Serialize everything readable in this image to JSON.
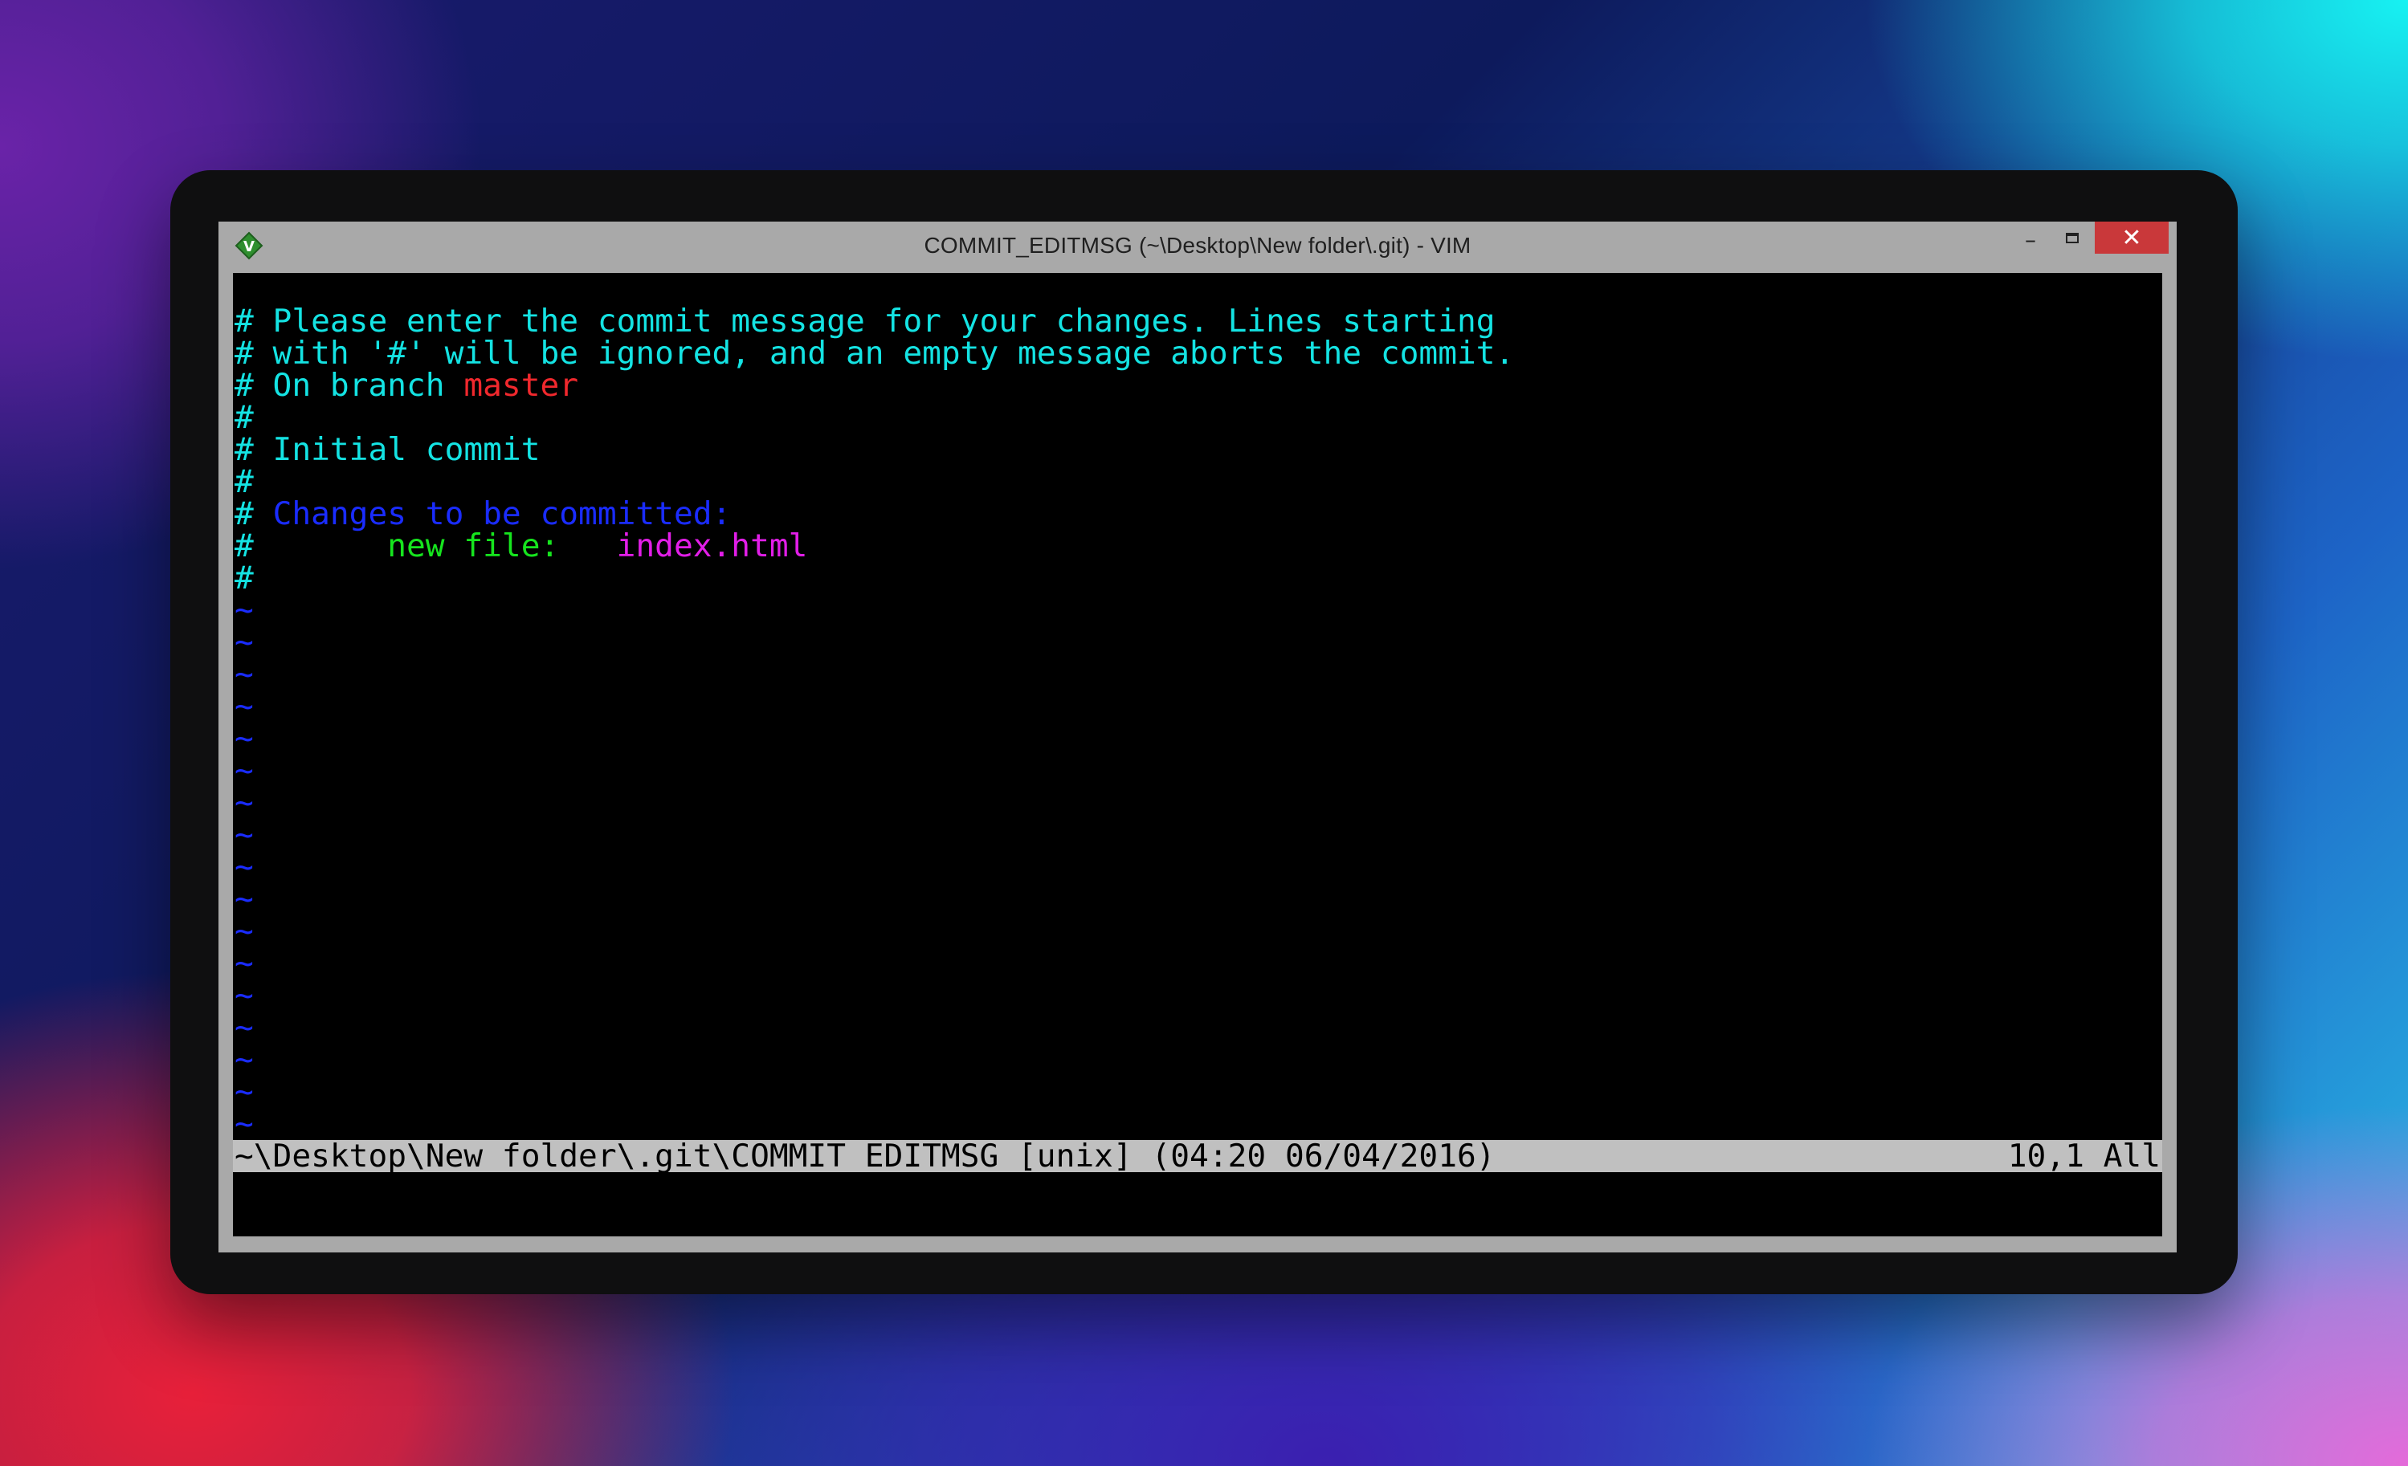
{
  "window": {
    "title": "COMMIT_EDITMSG (~\\Desktop\\New folder\\.git) - VIM",
    "app_icon": "vim-icon",
    "controls": {
      "minimize": "–",
      "maximize_icon": "maximize-icon",
      "close": "✕"
    }
  },
  "buffer": {
    "lines": [
      {
        "parts": [
          {
            "text": "# Please enter the commit message for your changes. Lines starting",
            "color": "cyan"
          }
        ]
      },
      {
        "parts": [
          {
            "text": "# with '#' will be ignored, and an empty message aborts the commit.",
            "color": "cyan"
          }
        ]
      },
      {
        "parts": [
          {
            "text": "# On branch ",
            "color": "cyan"
          },
          {
            "text": "master",
            "color": "red"
          }
        ]
      },
      {
        "parts": [
          {
            "text": "#",
            "color": "cyan"
          }
        ]
      },
      {
        "parts": [
          {
            "text": "# Initial commit",
            "color": "cyan"
          }
        ]
      },
      {
        "parts": [
          {
            "text": "#",
            "color": "cyan"
          }
        ]
      },
      {
        "parts": [
          {
            "text": "# ",
            "color": "cyan"
          },
          {
            "text": "Changes to be committed:",
            "color": "blue"
          }
        ]
      },
      {
        "parts": [
          {
            "text": "#",
            "color": "cyan"
          },
          {
            "text": "       new file:   ",
            "color": "green"
          },
          {
            "text": "index.html",
            "color": "magenta"
          }
        ]
      },
      {
        "parts": [
          {
            "text": "#",
            "color": "cyan"
          }
        ]
      }
    ],
    "empty_line_marker": "~",
    "empty_line_count": 18
  },
  "statusline": {
    "file_info": "~\\Desktop\\New folder\\.git\\COMMIT_EDITMSG [unix] (04:20 06/04/2016)",
    "position": "10,1 All"
  },
  "colors": {
    "cyan": "#14e3e3",
    "red": "#f0282d",
    "blue": "#1a2cff",
    "green": "#16e51e",
    "magenta": "#e21ee8",
    "close_button": "#c9383a",
    "statusline_bg": "#c0c0c0"
  }
}
